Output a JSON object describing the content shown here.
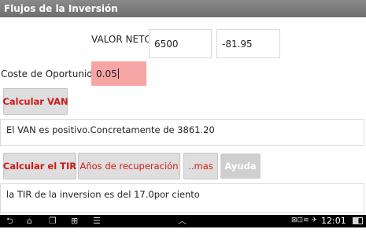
{
  "app": {
    "title": "Flujos de la Inversión"
  },
  "valor_neto": {
    "label": "VALOR NETO",
    "field1": "6500",
    "field2": "-81.95"
  },
  "coste": {
    "label": "Coste de Oportunidad",
    "value": "0.05"
  },
  "buttons": {
    "calcular_van": "Calcular VAN",
    "calcular_tir": "Calcular el TIR",
    "anos_recuperacion": "Años de recuperación",
    "mas": "..mas",
    "ayuda": "Ayuda"
  },
  "outputs": {
    "van": "El VAN es positivo.Concretamente de 3861.20",
    "tir": "la TIR de la inversion es del 17.0por ciento"
  },
  "system_bar": {
    "time": "12:01",
    "status_icons": "⊠⊡≋ ✈"
  },
  "colors": {
    "accent_red": "#cc1a1a",
    "field_highlight": "#f6a4a4",
    "title_bar": "#7a7a7a"
  }
}
